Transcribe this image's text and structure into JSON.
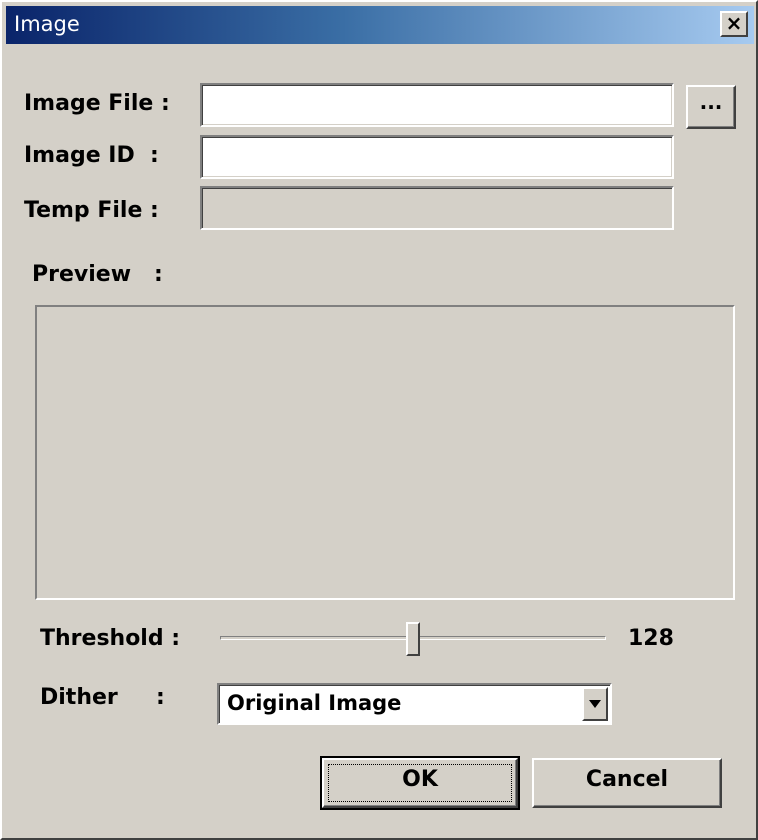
{
  "window": {
    "title": "Image",
    "close_label": "×"
  },
  "form": {
    "image_file_label": "Image File :",
    "image_file_value": "",
    "browse_label": "...",
    "image_id_label": "Image ID  :",
    "image_id_value": "",
    "temp_file_label": "Temp File :",
    "temp_file_value": "",
    "preview_label": "Preview   :"
  },
  "threshold": {
    "label": "Threshold :",
    "value": "128",
    "fraction": 0.5
  },
  "dither": {
    "label": "Dither     :",
    "selected": "Original Image"
  },
  "buttons": {
    "ok": "OK",
    "cancel": "Cancel"
  },
  "icons": {
    "close": "close-icon",
    "dropdown": "chevron-down-icon"
  }
}
